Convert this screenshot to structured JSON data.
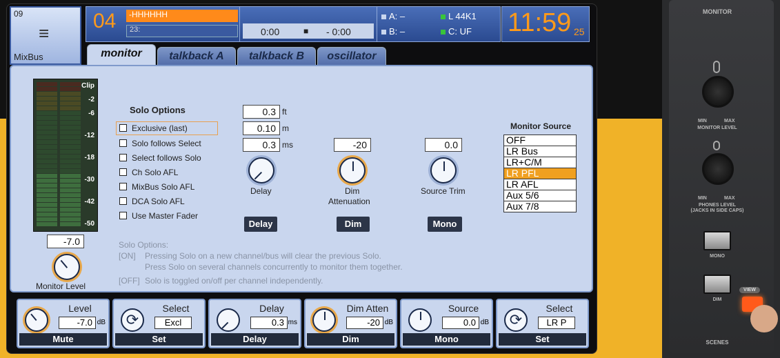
{
  "channel": {
    "number": "09",
    "name": "MixBus"
  },
  "scene": {
    "number": "04",
    "name": "-HHHHHH",
    "next": "23:"
  },
  "transport": {
    "elapsed": "0:00",
    "stop_icon": "stop-icon",
    "remaining": "- 0:00"
  },
  "status": {
    "a_label": "A:",
    "a_value": "–",
    "b_label": "B:",
    "b_value": "–",
    "l_label": "L",
    "l_value": "44K1",
    "c_label": "C:",
    "c_value": "UF"
  },
  "clock": {
    "time": "11:59",
    "seconds": "25"
  },
  "tabs": [
    {
      "label": "monitor",
      "active": true
    },
    {
      "label": "talkback A"
    },
    {
      "label": "talkback B"
    },
    {
      "label": "oscillator"
    }
  ],
  "meter": {
    "labels": [
      "Clip",
      "-2",
      "-6",
      "-12",
      "-18",
      "-30",
      "-42",
      "-50"
    ],
    "value": "-7.0",
    "knob_label": "Monitor Level",
    "level": 0.35
  },
  "solo": {
    "title": "Solo Options",
    "options": [
      "Exclusive (last)",
      "Solo follows Select",
      "Select follows Solo",
      "Ch Solo AFL",
      "MixBus Solo AFL",
      "DCA Solo AFL",
      "Use Master Fader"
    ]
  },
  "delay": {
    "ft_value": "0.3",
    "ft_unit": "ft",
    "m_value": "0.10",
    "m_unit": "m",
    "ms_value": "0.3",
    "ms_unit": "ms",
    "knob_label": "Delay",
    "button": "Delay"
  },
  "dim": {
    "value": "-20",
    "label1": "Dim",
    "label2": "Attenuation",
    "button": "Dim"
  },
  "source_trim": {
    "value": "0.0",
    "label": "Source Trim",
    "button": "Mono"
  },
  "monitor_source": {
    "title": "Monitor Source",
    "items": [
      "OFF",
      "LR Bus",
      "LR+C/M",
      "LR PFL",
      "LR AFL",
      "Aux 5/6",
      "Aux 7/8"
    ],
    "selected": "LR PFL"
  },
  "help": {
    "title": "Solo Options:",
    "on_tag": "[ON]",
    "on_line1": "Pressing Solo on a new channel/bus will clear the previous Solo.",
    "on_line2": "Press Solo on several channels concurrently to monitor them together.",
    "off_tag": "[OFF]",
    "off_line": "Solo is toggled on/off per channel independently."
  },
  "bottom": [
    {
      "title": "Level",
      "value": "-7.0",
      "unit": "dB",
      "button": "Mute",
      "icon": "knob"
    },
    {
      "title": "Select",
      "value": "Excl",
      "unit": "",
      "button": "Set",
      "icon": "cycle"
    },
    {
      "title": "Delay",
      "value": "0.3",
      "unit": "ms",
      "button": "Delay",
      "icon": "knob"
    },
    {
      "title": "Dim Atten",
      "value": "-20",
      "unit": "dB",
      "button": "Dim",
      "icon": "knob"
    },
    {
      "title": "Source",
      "value": "0.0",
      "unit": "dB",
      "button": "Mono",
      "icon": "knob"
    },
    {
      "title": "Select",
      "value": "LR P",
      "unit": "",
      "button": "Set",
      "icon": "cycle"
    }
  ],
  "hardware": {
    "section": "MONITOR",
    "knob1_min": "MIN",
    "knob1_max": "MAX",
    "knob1_label": "MONITOR LEVEL",
    "knob2_min": "MIN",
    "knob2_max": "MAX",
    "knob2_label": "PHONES LEVEL",
    "knob2_sub": "(JACKS IN SIDE CAPS)",
    "btn1": "MONO",
    "btn2": "DIM",
    "view": "VIEW",
    "footer": "SCENES"
  },
  "colors": {
    "accent": "#f0a020",
    "panel": "#c9d6ee",
    "tab": "#506ba8",
    "background_yellow": "#f0b228"
  }
}
